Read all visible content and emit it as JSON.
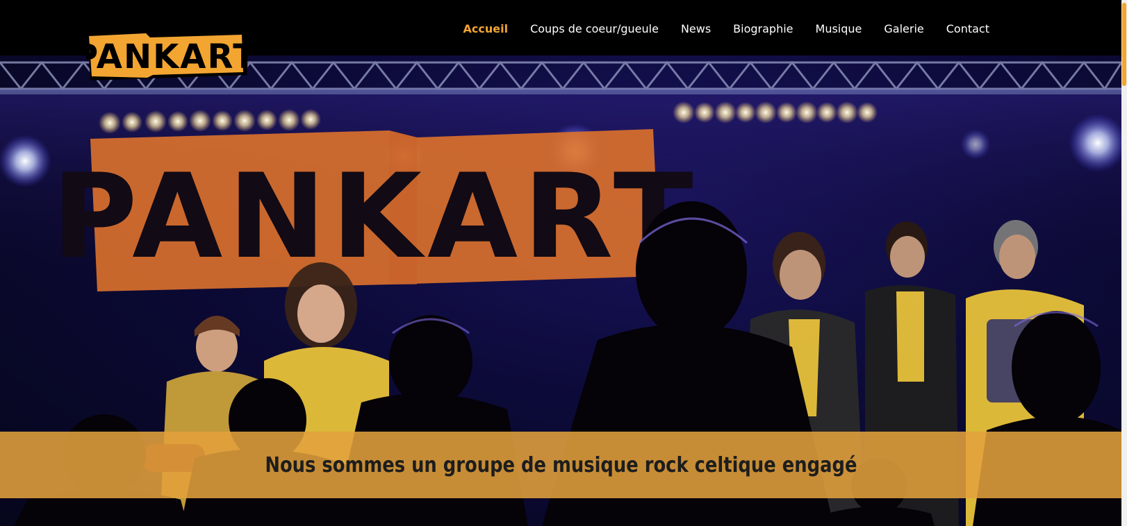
{
  "logo": {
    "text": "PANKART"
  },
  "nav": {
    "items": [
      {
        "label": "Accueil",
        "active": true
      },
      {
        "label": "Coups de coeur/gueule",
        "active": false
      },
      {
        "label": "News",
        "active": false
      },
      {
        "label": "Biographie",
        "active": false
      },
      {
        "label": "Musique",
        "active": false
      },
      {
        "label": "Galerie",
        "active": false
      },
      {
        "label": "Contact",
        "active": false
      }
    ]
  },
  "hero": {
    "banner_text": "PANKART",
    "tagline": "Nous sommes un groupe de musique rock celtique engagé"
  },
  "colors": {
    "accent": "#f2a531",
    "band": "#e2a03c",
    "banner": "#d9702c"
  }
}
